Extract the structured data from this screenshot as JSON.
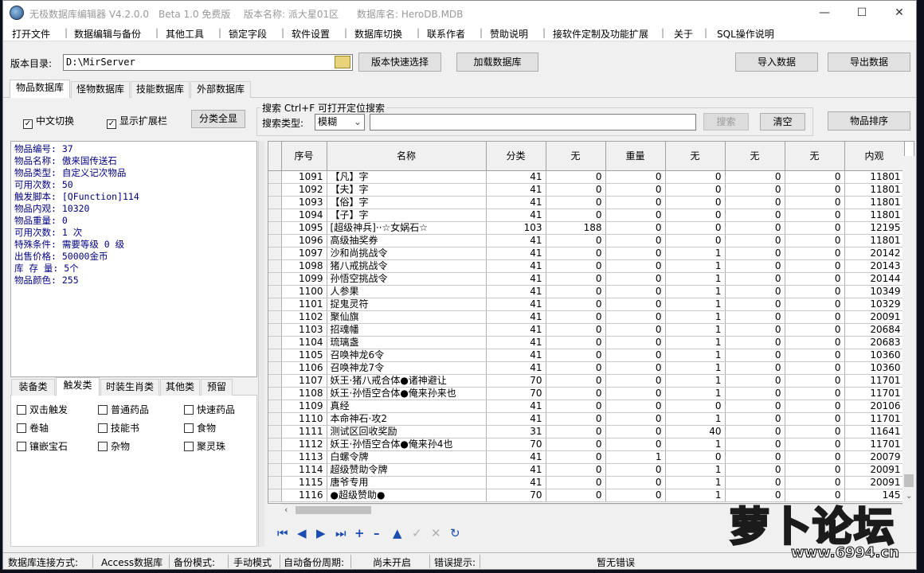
{
  "title": {
    "app": "无极数据库编辑器 V4.2.0.0",
    "beta": "Beta 1.0 免费版",
    "version": "版本名称: 派大星01区",
    "db": "数据库名: HeroDB.MDB"
  },
  "menu": [
    "打开文件",
    "数据编辑与备份",
    "其他工具",
    "锁定字段",
    "软件设置",
    "数据库切换",
    "联系作者",
    "赞助说明",
    "接软件定制及功能扩展",
    "关于",
    "SQL操作说明"
  ],
  "toolbar": {
    "dir_label": "版本目录:",
    "dir_value": "D:\\MirServer",
    "quick_select": "版本快速选择",
    "load_db": "加载数据库",
    "import": "导入数据",
    "export": "导出数据"
  },
  "tabs": [
    "物品数据库",
    "怪物数据库",
    "技能数据库",
    "外部数据库"
  ],
  "options": {
    "chinese": "中文切换",
    "ext": "显示扩展栏",
    "classify_all": "分类全显"
  },
  "search": {
    "group": "搜索  Ctrl+F 可打开定位搜索",
    "type_label": "搜索类型:",
    "type_value": "模糊",
    "button": "搜索",
    "clear": "清空",
    "sort": "物品排序"
  },
  "info": [
    "物品编号: 37",
    "物品名称: 傲来国传送石",
    "物品类型: 自定义记次物品",
    "可用次数: 50",
    "触发脚本: [QFunction]114",
    "物品内观: 10320",
    "物品重量: 0",
    "可用次数: 1 次",
    "特殊条件: 需要等级 0 级",
    "出售价格: 50000金币",
    "库 存 量: 5个",
    "物品颜色: 255"
  ],
  "cat_tabs": [
    "装备类",
    "触发类",
    "时装生肖类",
    "其他类",
    "预留"
  ],
  "cats": [
    "双击触发",
    "普通药品",
    "快速药品",
    "卷轴",
    "技能书",
    "食物",
    "镶嵌宝石",
    "杂物",
    "聚灵珠"
  ],
  "grid": {
    "headers": [
      "序号",
      "名称",
      "分类",
      "无",
      "重量",
      "无",
      "无",
      "无",
      "内观"
    ],
    "rows": [
      [
        "1091",
        "【凡】字",
        "41",
        "0",
        "0",
        "0",
        "0",
        "0",
        "11801"
      ],
      [
        "1092",
        "【夫】字",
        "41",
        "0",
        "0",
        "0",
        "0",
        "0",
        "11801"
      ],
      [
        "1093",
        "【俗】字",
        "41",
        "0",
        "0",
        "0",
        "0",
        "0",
        "11801"
      ],
      [
        "1094",
        "【子】字",
        "41",
        "0",
        "0",
        "0",
        "0",
        "0",
        "11801"
      ],
      [
        "1095",
        "[超级神兵]··☆女娲石☆",
        "103",
        "188",
        "0",
        "0",
        "0",
        "0",
        "12195"
      ],
      [
        "1096",
        "高级抽奖券",
        "41",
        "0",
        "0",
        "0",
        "0",
        "0",
        "11801"
      ],
      [
        "1097",
        "沙和尚挑战令",
        "41",
        "0",
        "0",
        "1",
        "0",
        "0",
        "20142"
      ],
      [
        "1098",
        "猪八戒挑战令",
        "41",
        "0",
        "0",
        "1",
        "0",
        "0",
        "20143"
      ],
      [
        "1099",
        "孙悟空挑战令",
        "41",
        "0",
        "0",
        "1",
        "0",
        "0",
        "20144"
      ],
      [
        "1100",
        "人参果",
        "41",
        "0",
        "0",
        "1",
        "0",
        "0",
        "10349"
      ],
      [
        "1101",
        "捉鬼灵符",
        "41",
        "0",
        "0",
        "1",
        "0",
        "0",
        "10329"
      ],
      [
        "1102",
        "聚仙旗",
        "41",
        "0",
        "0",
        "1",
        "0",
        "0",
        "20091"
      ],
      [
        "1103",
        "招魂幡",
        "41",
        "0",
        "0",
        "1",
        "0",
        "0",
        "20684"
      ],
      [
        "1104",
        "琉璃盏",
        "41",
        "0",
        "0",
        "1",
        "0",
        "0",
        "20683"
      ],
      [
        "1105",
        "召唤神龙6令",
        "41",
        "0",
        "0",
        "1",
        "0",
        "0",
        "10360"
      ],
      [
        "1106",
        "召唤神龙7令",
        "41",
        "0",
        "0",
        "1",
        "0",
        "0",
        "10360"
      ],
      [
        "1107",
        "妖王·猪八戒合体●诸神避让",
        "70",
        "0",
        "0",
        "1",
        "0",
        "0",
        "11701"
      ],
      [
        "1108",
        "妖王·孙悟空合体●俺来孙来也",
        "70",
        "0",
        "0",
        "1",
        "0",
        "0",
        "11701"
      ],
      [
        "1109",
        "真经",
        "41",
        "0",
        "0",
        "0",
        "0",
        "0",
        "20106"
      ],
      [
        "1110",
        "本命神石·攻2",
        "41",
        "0",
        "0",
        "1",
        "0",
        "0",
        "11701"
      ],
      [
        "1111",
        "测试区回收奖励",
        "31",
        "0",
        "0",
        "40",
        "0",
        "0",
        "11641"
      ],
      [
        "1112",
        "妖王·孙悟空合体●俺来孙4也",
        "70",
        "0",
        "0",
        "1",
        "0",
        "0",
        "11701"
      ],
      [
        "1113",
        "白螺令牌",
        "41",
        "0",
        "1",
        "0",
        "0",
        "0",
        "20079"
      ],
      [
        "1114",
        "超级赞助令牌",
        "41",
        "0",
        "0",
        "1",
        "0",
        "0",
        "20091"
      ],
      [
        "1115",
        "唐爷专用",
        "41",
        "0",
        "0",
        "1",
        "0",
        "0",
        "20091"
      ],
      [
        "1116",
        "●超级赞助●",
        "70",
        "0",
        "0",
        "1",
        "0",
        "0",
        "145"
      ]
    ]
  },
  "status": {
    "conn_label": "数据库连接方式:",
    "conn_value": "Access数据库",
    "backup_label": "备份模式:",
    "backup_value": "手动模式",
    "auto_label": "自动备份周期:",
    "auto_value": "尚未开启",
    "err_label": "错误提示:",
    "err_value": "暂无错误"
  },
  "watermark": {
    "text": "萝卜论坛",
    "url": "www.6994.cn"
  }
}
